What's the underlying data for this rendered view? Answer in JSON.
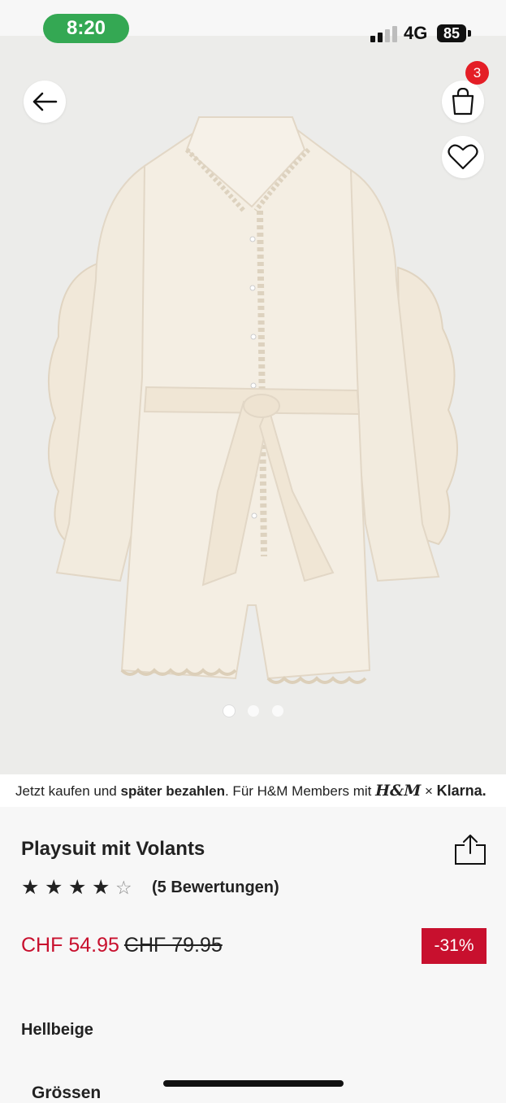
{
  "status_bar": {
    "time": "8:20",
    "network": "4G",
    "battery": "85"
  },
  "header": {
    "cart_count": "3"
  },
  "gallery": {
    "total_images": 3,
    "active_index": 0
  },
  "klarna_banner": {
    "text_1": "Jetzt kaufen und ",
    "text_bold": "später bezahlen",
    "text_2": ". Für H&M Members mit ",
    "hm_logo": "H&M",
    "separator": " × ",
    "klarna_logo": "Klarna."
  },
  "product": {
    "title": "Playsuit mit Volants",
    "rating": 4,
    "rating_max": 5,
    "reviews": "(5 Bewertungen)",
    "price_sale": "CHF 54.95",
    "price_original": "CHF 79.95",
    "discount": "-31%",
    "color": "Hellbeige",
    "sizes_label": "Grössen"
  },
  "colors": {
    "sale": "#c8102e",
    "badge": "#e41e26",
    "status_pill": "#34a853"
  }
}
